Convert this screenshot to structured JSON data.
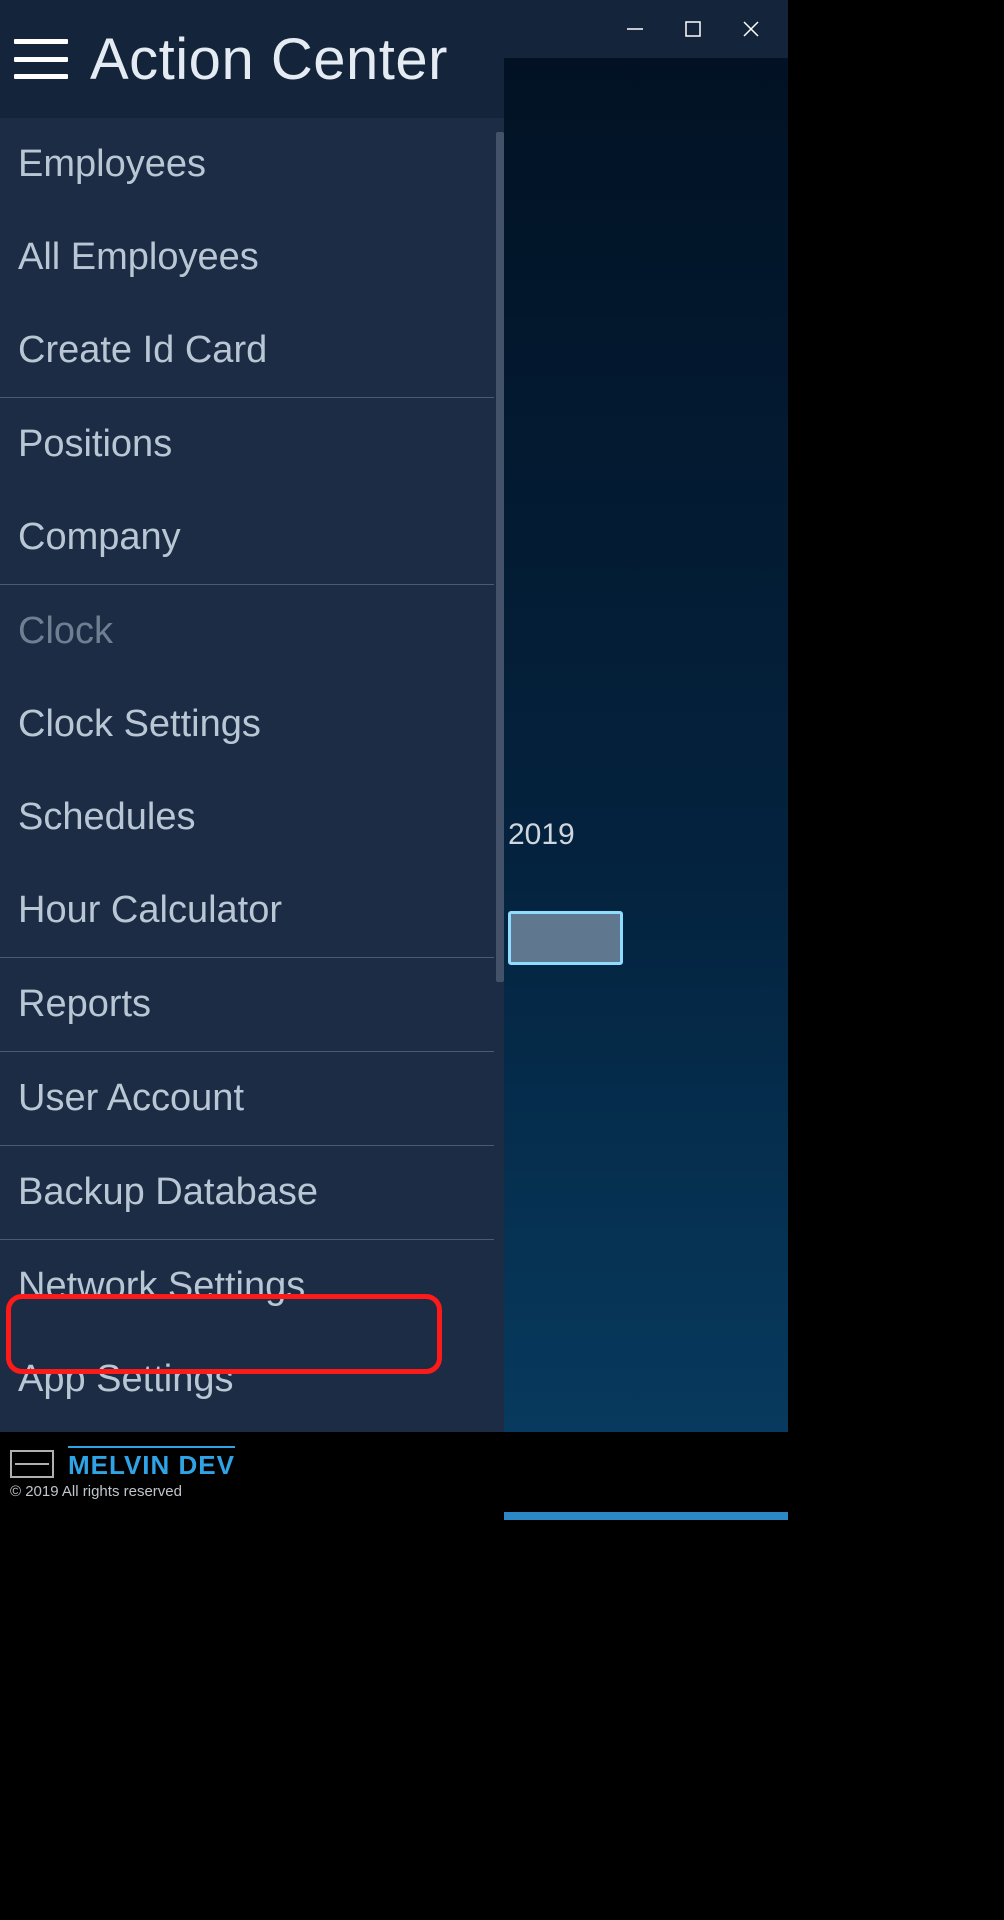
{
  "titlebar": {},
  "sidebar": {
    "title": "Action Center",
    "items": [
      {
        "label": "Employees",
        "dim": false,
        "sep_after": false
      },
      {
        "label": "All Employees",
        "dim": false,
        "sep_after": false
      },
      {
        "label": "Create Id Card",
        "dim": false,
        "sep_after": true
      },
      {
        "label": "Positions",
        "dim": false,
        "sep_after": false
      },
      {
        "label": "Company",
        "dim": false,
        "sep_after": true
      },
      {
        "label": "Clock",
        "dim": true,
        "sep_after": false
      },
      {
        "label": "Clock Settings",
        "dim": false,
        "sep_after": false
      },
      {
        "label": "Schedules",
        "dim": false,
        "sep_after": false
      },
      {
        "label": "Hour Calculator",
        "dim": false,
        "sep_after": true
      },
      {
        "label": "Reports",
        "dim": false,
        "sep_after": true
      },
      {
        "label": "User Account",
        "dim": false,
        "sep_after": true
      },
      {
        "label": "Backup Database",
        "dim": false,
        "sep_after": true,
        "highlight": true
      },
      {
        "label": "Network Settings",
        "dim": false,
        "sep_after": false
      },
      {
        "label": "App Settings",
        "dim": false,
        "sep_after": false
      }
    ]
  },
  "background": {
    "year_text": "2019"
  },
  "footer": {
    "brand": "MELVIN DEV",
    "copyright": "© 2019 All rights reserved"
  }
}
